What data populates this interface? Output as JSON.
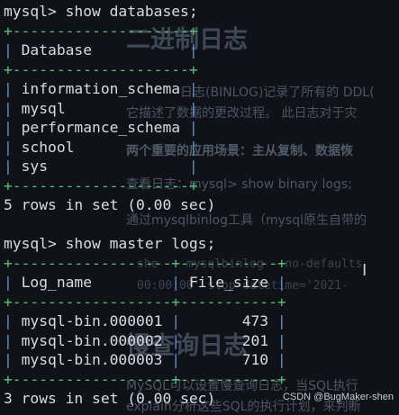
{
  "background": {
    "heading1": "二进制日志",
    "para1_line1": "日志(BINLOG)记录了所有的 DDL(",
    "para1_line2": "它描述了数据的更改过程。 此日志对于灾",
    "bold_line": "两个重要的应用场景：主从复制、数据恢",
    "query_line": "查看日志：mysql> show binary logs;",
    "tool_line": "通过mysqlbinlog工具（mysql原生自带的",
    "code_line1": "she  --  mysqlbinlog --no-defaults",
    "code_line2": "00:00:00'  stop-datetime='2021-",
    "heading2": "慢查询日志",
    "para2_line1": "MySQL可以设置慢查询日志，当SQL执行",
    "para2_line2": "explain分析这些SQL的执行计划，来判断"
  },
  "terminal": {
    "cmd1": "mysql> show databases;",
    "border_databases": "+--------------------+",
    "db_header": "Database",
    "databases": [
      "information_schema",
      "mysql",
      "performance_schema",
      "school",
      "sys"
    ],
    "result1": "5 rows in set (0.00 sec)",
    "cmd2": "mysql> show master logs;",
    "border_logs": "+------------------+-----------+",
    "log_col1": "Log_name",
    "log_col2": "File_size",
    "logs": [
      {
        "name": "mysql-bin.000001",
        "size": "473"
      },
      {
        "name": "mysql-bin.000002",
        "size": "201"
      },
      {
        "name": "mysql-bin.000003",
        "size": "710"
      }
    ],
    "result2": "3 rows in set (0.00 sec)"
  },
  "watermark": "CSDN @BugMaker-shen"
}
